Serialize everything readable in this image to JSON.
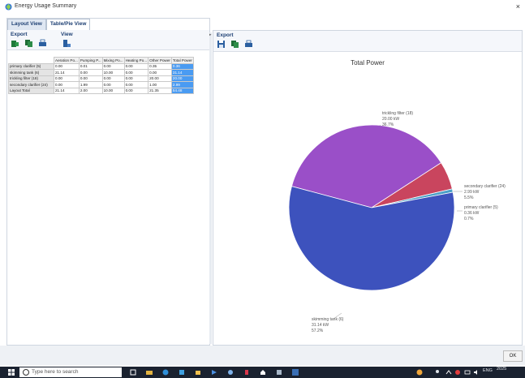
{
  "window": {
    "title": "Energy Usage Summary",
    "close_glyph": "×"
  },
  "tabs": [
    {
      "label": "Layout View"
    },
    {
      "label": "Table/Pie View"
    }
  ],
  "left_toolbar": {
    "export_label": "Export",
    "view_label": "View"
  },
  "right_toolbar": {
    "export_label": "Export"
  },
  "table": {
    "columns": [
      "Aeration Po...",
      "Pumping P...",
      "Mixing Po...",
      "Heating Po...",
      "Other Power",
      "Total Power"
    ],
    "rows": [
      {
        "name": "primary clarifier (5)",
        "values": [
          "0.00",
          "0.01",
          "0.00",
          "0.00",
          "0.35",
          "0.36"
        ]
      },
      {
        "name": "skimming tank (6)",
        "values": [
          "21.14",
          "0.00",
          "10.00",
          "0.00",
          "0.00",
          "31.14"
        ]
      },
      {
        "name": "trickling filter (18)",
        "values": [
          "0.00",
          "0.00",
          "0.00",
          "0.00",
          "20.00",
          "20.00"
        ]
      },
      {
        "name": "secondary clarifier (24)",
        "values": [
          "0.00",
          "1.99",
          "0.00",
          "0.00",
          "1.00",
          "2.99"
        ]
      },
      {
        "name": "Layout Total",
        "values": [
          "21.14",
          "2.00",
          "10.00",
          "0.00",
          "21.35",
          "54.48"
        ]
      }
    ]
  },
  "chart_data": {
    "type": "pie",
    "title": "Total Power",
    "unit": "kW",
    "slices": [
      {
        "label": "trickling filter (18)",
        "value": 20.0,
        "value_text": "20.00 kW",
        "percent_text": "36.7%",
        "color": "#9a4fc8"
      },
      {
        "label": "secondary clarifier (24)",
        "value": 2.99,
        "value_text": "2.99 kW",
        "percent_text": "5.5%",
        "color": "#c9455e"
      },
      {
        "label": "primary clarifier (5)",
        "value": 0.36,
        "value_text": "0.36 kW",
        "percent_text": "0.7%",
        "color": "#4aa0c7"
      },
      {
        "label": "skimming tank (6)",
        "value": 31.14,
        "value_text": "31.14 kW",
        "percent_text": "57.2%",
        "color": "#3d52bd"
      }
    ]
  },
  "ok_button": {
    "label": "OK"
  },
  "taskbar": {
    "search_placeholder": "Type here to search",
    "lang": "ENG",
    "year": "2025"
  }
}
